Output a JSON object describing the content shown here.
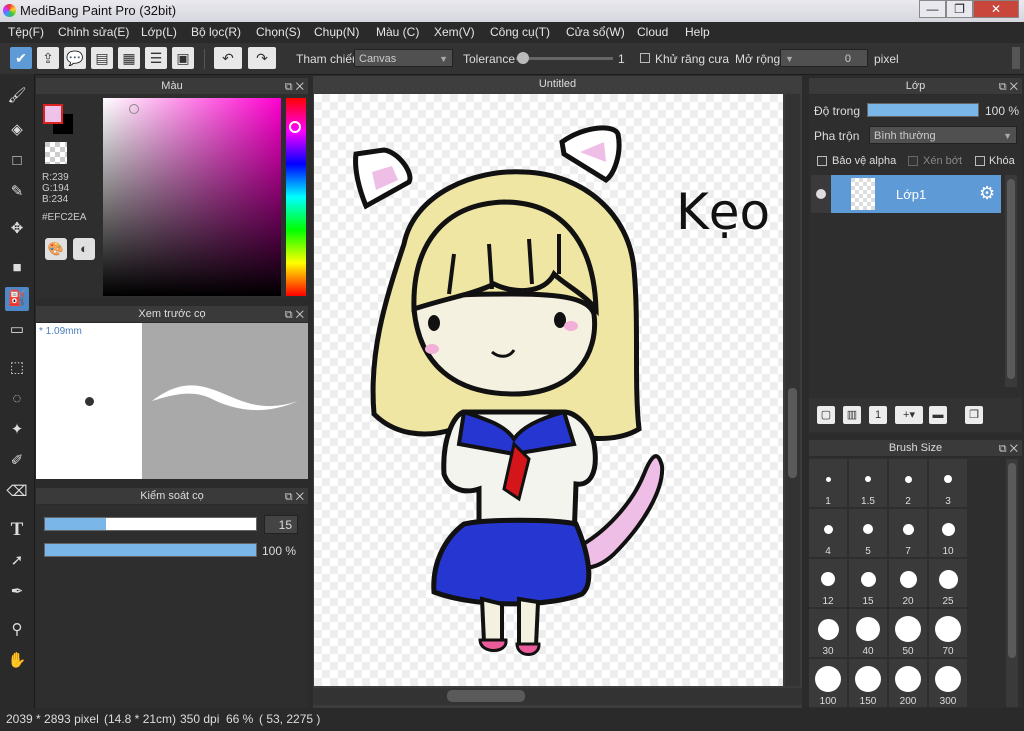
{
  "window": {
    "title": "MediBang Paint Pro (32bit)",
    "min": "—",
    "max": "❐",
    "close": "✕"
  },
  "menu": [
    "Tệp(F)",
    "Chỉnh sửa(E)",
    "Lớp(L)",
    "Bộ lọc(R)",
    "Chọn(S)",
    "Chụp(N)",
    "Màu (C)",
    "Xem(V)",
    "Công cụ(T)",
    "Cửa sổ(W)",
    "Cloud",
    "Help"
  ],
  "toolbar": {
    "reference_label": "Tham chiếu",
    "reference_value": "Canvas",
    "tolerance_label": "Tolerance",
    "tolerance_value": "1",
    "antialias_label": "Khử răng cưa",
    "expand_label": "Mở rộng",
    "expand_value": "0",
    "expand_unit": "pixel"
  },
  "color_panel": {
    "title": "Màu",
    "r": "R:239",
    "g": "G:194",
    "b": "B:234",
    "hex": "#EFC2EA",
    "fg_color": "#EFC2EA"
  },
  "brush_preview": {
    "title": "Xem trước cọ",
    "size": "* 1.09mm"
  },
  "brush_control": {
    "title": "Kiểm soát cọ",
    "size_value": "15",
    "size_fraction": 0.29,
    "opacity_value": "100 %",
    "opacity_fraction": 1.0
  },
  "canvas": {
    "tab_title": "Untitled",
    "handwriting": "Kẹo"
  },
  "layer_panel": {
    "title": "Lớp",
    "opacity_label": "Độ trong",
    "opacity_value": "100 %",
    "blend_label": "Pha trộn",
    "blend_value": "Bình thường",
    "protect_alpha": "Bảo vệ alpha",
    "clipping": "Xén bớt",
    "lock": "Khóa",
    "layers": [
      {
        "name": "Lớp1"
      }
    ]
  },
  "brush_size_panel": {
    "title": "Brush Size",
    "sizes": [
      "1",
      "1.5",
      "2",
      "3",
      "4",
      "5",
      "7",
      "10",
      "12",
      "15",
      "20",
      "25",
      "30",
      "40",
      "50",
      "70",
      "100",
      "150",
      "200",
      "300"
    ]
  },
  "status": {
    "dimensions": "2039 * 2893 pixel",
    "physical": "(14.8 * 21cm)",
    "dpi": "350 dpi",
    "zoom": "66 %",
    "cursor": "( 53, 2275 )"
  }
}
